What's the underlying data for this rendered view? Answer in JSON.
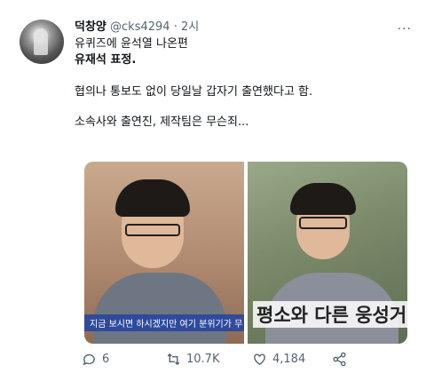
{
  "tweet": {
    "display_name": "덕창양",
    "handle": "@cks4294",
    "separator": "·",
    "time": "2시",
    "more": "···",
    "line1": "유퀴즈에 윤석열 나온편",
    "line2": "유재석 표정.",
    "line3": "협의나 통보도 없이 당일날 갑자기 출연했다고 함.",
    "line4": "소속사와 출연진, 제작팀은 무슨죄..."
  },
  "media": {
    "left_caption": "지금 보시면 하시겠지만 여기 분위기가 무",
    "right_caption": "평소와 다른 웅성거"
  },
  "actions": {
    "reply_count": "6",
    "retweet_count": "10.7K",
    "like_count": "4,184"
  },
  "colors": {
    "text": "#0f1419",
    "secondary": "#536471"
  }
}
